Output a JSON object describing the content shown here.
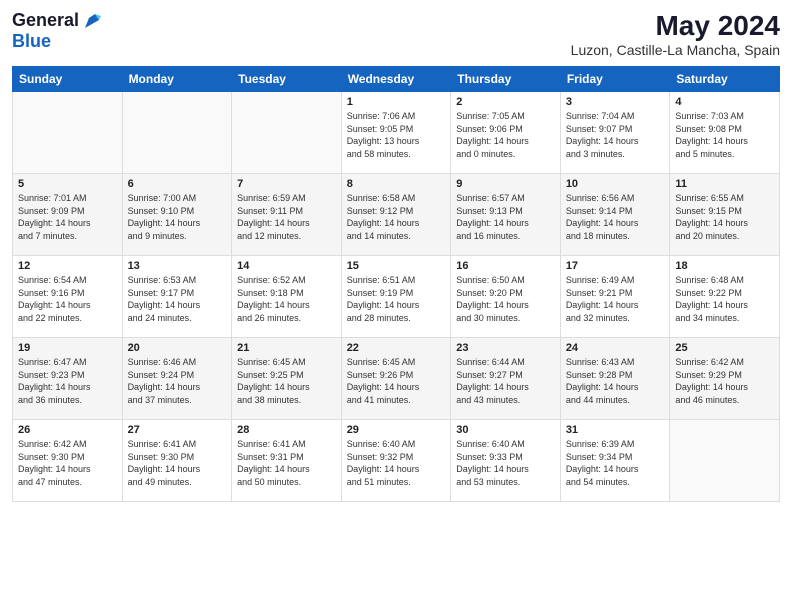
{
  "logo": {
    "line1": "General",
    "line2": "Blue"
  },
  "title": "May 2024",
  "location": "Luzon, Castille-La Mancha, Spain",
  "headers": [
    "Sunday",
    "Monday",
    "Tuesday",
    "Wednesday",
    "Thursday",
    "Friday",
    "Saturday"
  ],
  "weeks": [
    [
      {
        "day": "",
        "info": ""
      },
      {
        "day": "",
        "info": ""
      },
      {
        "day": "",
        "info": ""
      },
      {
        "day": "1",
        "info": "Sunrise: 7:06 AM\nSunset: 9:05 PM\nDaylight: 13 hours\nand 58 minutes."
      },
      {
        "day": "2",
        "info": "Sunrise: 7:05 AM\nSunset: 9:06 PM\nDaylight: 14 hours\nand 0 minutes."
      },
      {
        "day": "3",
        "info": "Sunrise: 7:04 AM\nSunset: 9:07 PM\nDaylight: 14 hours\nand 3 minutes."
      },
      {
        "day": "4",
        "info": "Sunrise: 7:03 AM\nSunset: 9:08 PM\nDaylight: 14 hours\nand 5 minutes."
      }
    ],
    [
      {
        "day": "5",
        "info": "Sunrise: 7:01 AM\nSunset: 9:09 PM\nDaylight: 14 hours\nand 7 minutes."
      },
      {
        "day": "6",
        "info": "Sunrise: 7:00 AM\nSunset: 9:10 PM\nDaylight: 14 hours\nand 9 minutes."
      },
      {
        "day": "7",
        "info": "Sunrise: 6:59 AM\nSunset: 9:11 PM\nDaylight: 14 hours\nand 12 minutes."
      },
      {
        "day": "8",
        "info": "Sunrise: 6:58 AM\nSunset: 9:12 PM\nDaylight: 14 hours\nand 14 minutes."
      },
      {
        "day": "9",
        "info": "Sunrise: 6:57 AM\nSunset: 9:13 PM\nDaylight: 14 hours\nand 16 minutes."
      },
      {
        "day": "10",
        "info": "Sunrise: 6:56 AM\nSunset: 9:14 PM\nDaylight: 14 hours\nand 18 minutes."
      },
      {
        "day": "11",
        "info": "Sunrise: 6:55 AM\nSunset: 9:15 PM\nDaylight: 14 hours\nand 20 minutes."
      }
    ],
    [
      {
        "day": "12",
        "info": "Sunrise: 6:54 AM\nSunset: 9:16 PM\nDaylight: 14 hours\nand 22 minutes."
      },
      {
        "day": "13",
        "info": "Sunrise: 6:53 AM\nSunset: 9:17 PM\nDaylight: 14 hours\nand 24 minutes."
      },
      {
        "day": "14",
        "info": "Sunrise: 6:52 AM\nSunset: 9:18 PM\nDaylight: 14 hours\nand 26 minutes."
      },
      {
        "day": "15",
        "info": "Sunrise: 6:51 AM\nSunset: 9:19 PM\nDaylight: 14 hours\nand 28 minutes."
      },
      {
        "day": "16",
        "info": "Sunrise: 6:50 AM\nSunset: 9:20 PM\nDaylight: 14 hours\nand 30 minutes."
      },
      {
        "day": "17",
        "info": "Sunrise: 6:49 AM\nSunset: 9:21 PM\nDaylight: 14 hours\nand 32 minutes."
      },
      {
        "day": "18",
        "info": "Sunrise: 6:48 AM\nSunset: 9:22 PM\nDaylight: 14 hours\nand 34 minutes."
      }
    ],
    [
      {
        "day": "19",
        "info": "Sunrise: 6:47 AM\nSunset: 9:23 PM\nDaylight: 14 hours\nand 36 minutes."
      },
      {
        "day": "20",
        "info": "Sunrise: 6:46 AM\nSunset: 9:24 PM\nDaylight: 14 hours\nand 37 minutes."
      },
      {
        "day": "21",
        "info": "Sunrise: 6:45 AM\nSunset: 9:25 PM\nDaylight: 14 hours\nand 38 minutes."
      },
      {
        "day": "22",
        "info": "Sunrise: 6:45 AM\nSunset: 9:26 PM\nDaylight: 14 hours\nand 41 minutes."
      },
      {
        "day": "23",
        "info": "Sunrise: 6:44 AM\nSunset: 9:27 PM\nDaylight: 14 hours\nand 43 minutes."
      },
      {
        "day": "24",
        "info": "Sunrise: 6:43 AM\nSunset: 9:28 PM\nDaylight: 14 hours\nand 44 minutes."
      },
      {
        "day": "25",
        "info": "Sunrise: 6:42 AM\nSunset: 9:29 PM\nDaylight: 14 hours\nand 46 minutes."
      }
    ],
    [
      {
        "day": "26",
        "info": "Sunrise: 6:42 AM\nSunset: 9:30 PM\nDaylight: 14 hours\nand 47 minutes."
      },
      {
        "day": "27",
        "info": "Sunrise: 6:41 AM\nSunset: 9:30 PM\nDaylight: 14 hours\nand 49 minutes."
      },
      {
        "day": "28",
        "info": "Sunrise: 6:41 AM\nSunset: 9:31 PM\nDaylight: 14 hours\nand 50 minutes."
      },
      {
        "day": "29",
        "info": "Sunrise: 6:40 AM\nSunset: 9:32 PM\nDaylight: 14 hours\nand 51 minutes."
      },
      {
        "day": "30",
        "info": "Sunrise: 6:40 AM\nSunset: 9:33 PM\nDaylight: 14 hours\nand 53 minutes."
      },
      {
        "day": "31",
        "info": "Sunrise: 6:39 AM\nSunset: 9:34 PM\nDaylight: 14 hours\nand 54 minutes."
      },
      {
        "day": "",
        "info": ""
      }
    ]
  ]
}
